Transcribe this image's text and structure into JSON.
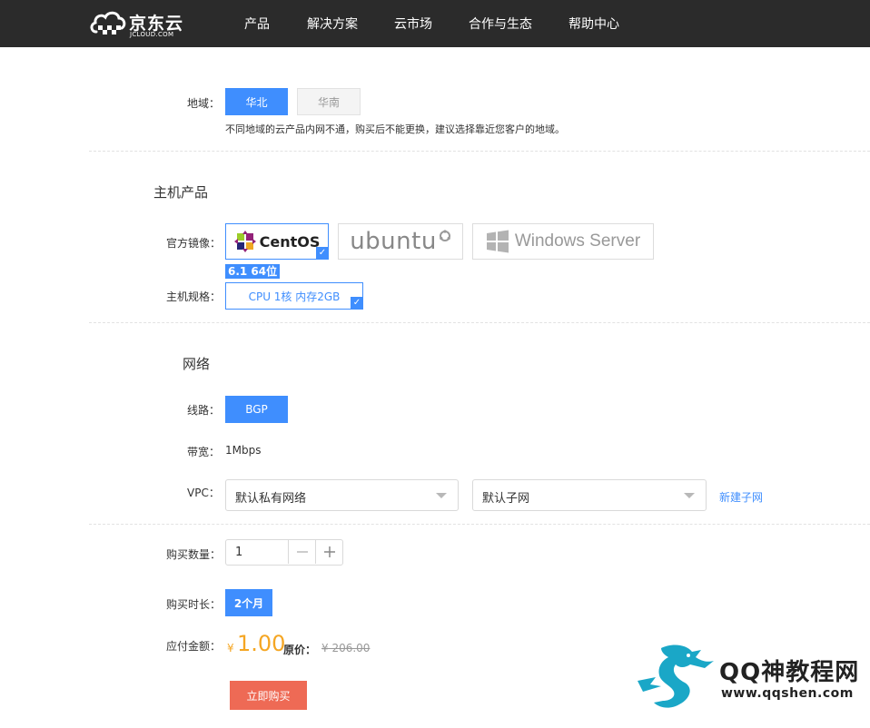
{
  "header": {
    "logo_cn": "京东云",
    "logo_en": "JCLOUD.COM",
    "nav": [
      "产品",
      "解决方案",
      "云市场",
      "合作与生态",
      "帮助中心"
    ]
  },
  "region": {
    "label": "地域：",
    "options": [
      "华北",
      "华南"
    ],
    "selected": "华北",
    "hint": "不同地域的云产品内网不通，购买后不能更换，建议选择靠近您客户的地域。"
  },
  "host": {
    "section_title": "主机产品",
    "image_label": "官方镜像：",
    "images": [
      "CentOS",
      "ubuntu",
      "Windows Server"
    ],
    "selected_image": "CentOS",
    "version": "6.1 64位",
    "spec_label": "主机规格：",
    "spec_value": "CPU 1核 内存2GB"
  },
  "network": {
    "section_title": "网络",
    "line_label": "线路：",
    "line_value": "BGP",
    "bandwidth_label": "带宽：",
    "bandwidth_value": "1Mbps",
    "vpc_label": "VPC：",
    "vpc_value": "默认私有网络",
    "subnet_value": "默认子网",
    "new_subnet_link": "新建子网"
  },
  "purchase": {
    "quantity_label": "购买数量：",
    "quantity_value": "1",
    "duration_label": "购买时长：",
    "duration_value": "2个月",
    "amount_label": "应付金额：",
    "currency": "¥",
    "price": "1.00",
    "orig_label": "原价：",
    "orig_price": "¥ 206.00",
    "buy_label": "立即购买"
  },
  "watermark": {
    "title": "QQ神教程网",
    "url": "www.qqshen.com"
  },
  "colors": {
    "accent": "#3f8efe",
    "price": "#f5a623",
    "buy": "#ee6a55",
    "topbar": "#2b2b2b"
  }
}
